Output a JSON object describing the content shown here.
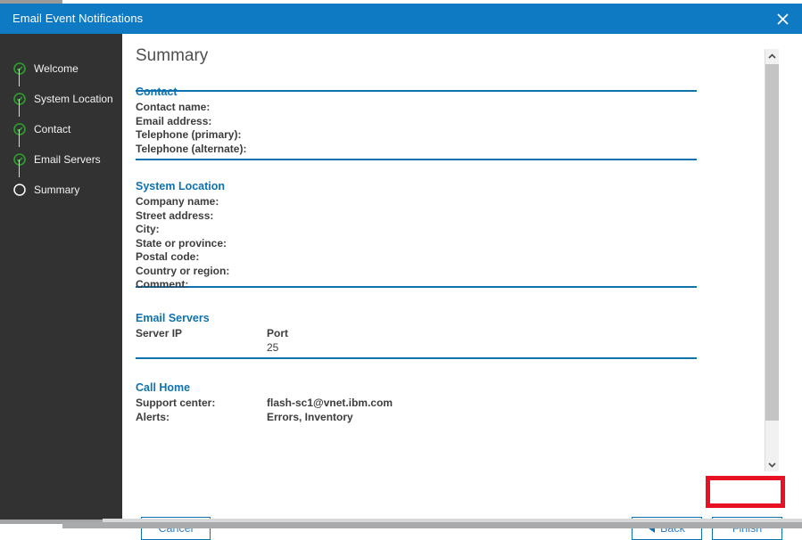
{
  "window": {
    "title": "Email Event Notifications",
    "close_icon": "close-x-icon"
  },
  "sidebar": {
    "steps": [
      {
        "label": "Welcome",
        "state": "complete",
        "icon": "check-circle-icon"
      },
      {
        "label": "System Location",
        "state": "complete",
        "icon": "check-circle-icon"
      },
      {
        "label": "Contact",
        "state": "complete",
        "icon": "check-circle-icon"
      },
      {
        "label": "Email Servers",
        "state": "complete",
        "icon": "check-circle-icon"
      },
      {
        "label": "Summary",
        "state": "current",
        "icon": "empty-circle-icon"
      }
    ]
  },
  "main": {
    "page_title": "Summary",
    "sections": [
      {
        "id": "contact",
        "title": "Contact",
        "rows": [
          {
            "key": "Contact name:",
            "value": ""
          },
          {
            "key": "Email address:",
            "value": ""
          },
          {
            "key": "Telephone (primary):",
            "value": ""
          },
          {
            "key": "Telephone (alternate):",
            "value": ""
          }
        ]
      },
      {
        "id": "system-location",
        "title": "System Location",
        "rows": [
          {
            "key": "Company name:",
            "value": ""
          },
          {
            "key": "Street address:",
            "value": ""
          },
          {
            "key": "City:",
            "value": ""
          },
          {
            "key": "State or province:",
            "value": ""
          },
          {
            "key": "Postal code:",
            "value": ""
          },
          {
            "key": "Country or region:",
            "value": ""
          },
          {
            "key": "Comment:",
            "value": ""
          }
        ]
      },
      {
        "id": "email-servers",
        "title": "Email Servers",
        "table": {
          "headers": [
            "Server IP",
            "Port"
          ],
          "rows": [
            [
              "",
              "25"
            ]
          ]
        }
      },
      {
        "id": "call-home",
        "title": "Call Home",
        "rows": [
          {
            "key": "Support center:",
            "value": "flash-sc1@vnet.ibm.com"
          },
          {
            "key": "Alerts:",
            "value": "Errors, Inventory"
          }
        ]
      }
    ]
  },
  "footer": {
    "cancel_label": "Cancel",
    "back_label": "Back",
    "finish_label": "Finish"
  },
  "scrollbar": {
    "up_icon": "chevron-up-icon",
    "down_icon": "chevron-down-icon"
  },
  "colors": {
    "titlebar_blue": "#0f7ac4",
    "accent_blue": "#0f72b0",
    "sidebar_dark": "#323232",
    "step_complete_green": "#2ca02c",
    "highlight_red": "#e81123"
  }
}
